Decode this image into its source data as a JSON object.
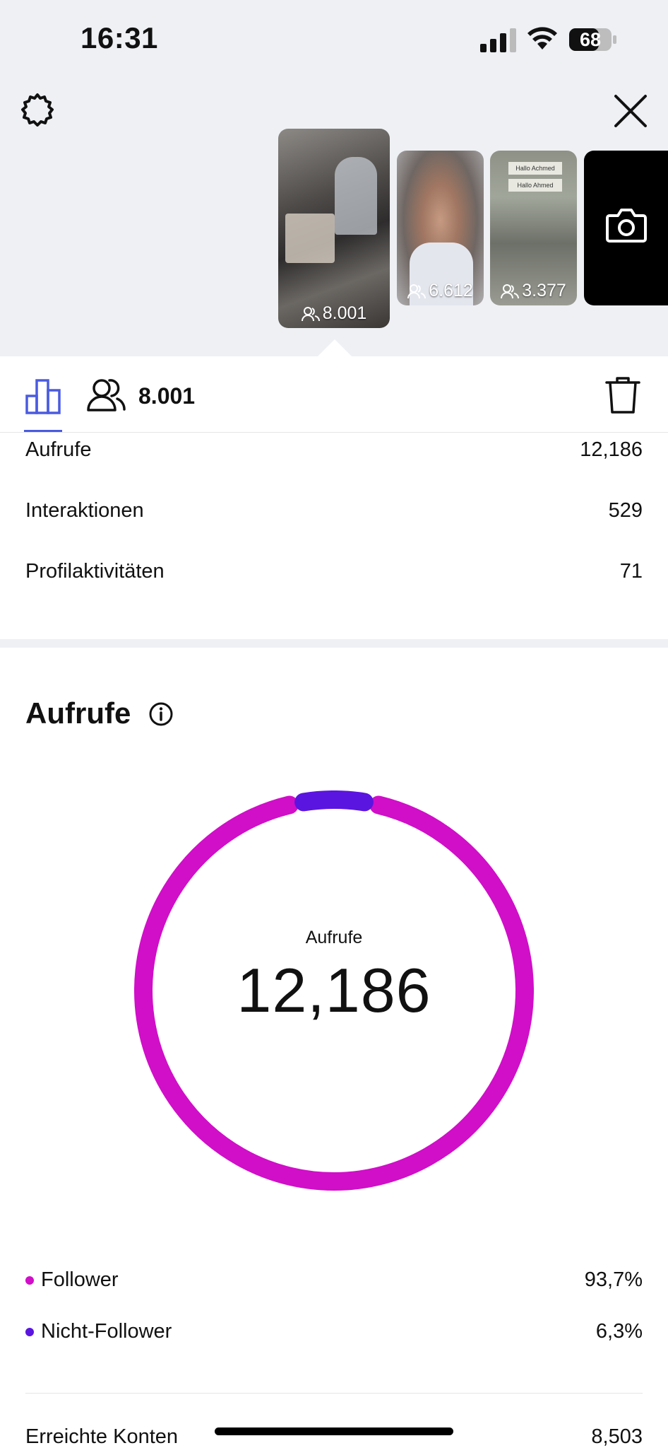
{
  "status_bar": {
    "time": "16:31",
    "battery": "68"
  },
  "stories": [
    {
      "count": "8.001",
      "selected": true
    },
    {
      "count": "6.612",
      "selected": false
    },
    {
      "count": "3.377",
      "selected": false,
      "notes": [
        "Hallo Achmed",
        "Hallo Ahmed"
      ]
    }
  ],
  "tabs": {
    "reach_count": "8.001"
  },
  "metrics": [
    {
      "label": "Aufrufe",
      "value": "12,186"
    },
    {
      "label": "Interaktionen",
      "value": "529"
    },
    {
      "label": "Profilaktivitäten",
      "value": "71"
    }
  ],
  "views_section": {
    "title": "Aufrufe",
    "center_label": "Aufrufe",
    "center_value": "12,186"
  },
  "chart_data": {
    "type": "pie",
    "categories": [
      "Follower",
      "Nicht-Follower"
    ],
    "values": [
      93.7,
      6.3
    ],
    "colors": [
      "#d10ec8",
      "#5b15e0"
    ]
  },
  "legend": [
    {
      "label": "Follower",
      "value": "93,7%",
      "color": "#d10ec8"
    },
    {
      "label": "Nicht-Follower",
      "value": "6,3%",
      "color": "#5b15e0"
    }
  ],
  "reached": {
    "label": "Erreichte Konten",
    "value": "8,503"
  }
}
